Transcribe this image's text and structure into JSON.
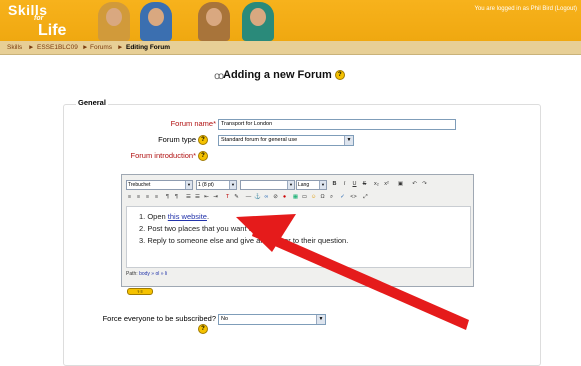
{
  "header": {
    "logo_line1": "Skills",
    "logo_line2": "for",
    "logo_line3": "Life",
    "logged_in_text": "You are logged in as Phil Bird (Logout)"
  },
  "breadcrumb": {
    "items": [
      "Skills",
      "ESSE1BLC09",
      "Forums",
      "Editing Forum"
    ],
    "separator": "►"
  },
  "page": {
    "title": "Adding a new Forum",
    "section_legend": "General"
  },
  "form": {
    "forum_name_label": "Forum name*",
    "forum_name_value": "Transport for London",
    "forum_type_label": "Forum type",
    "forum_type_value": "Standard forum for general use",
    "forum_intro_label": "Forum introduction*",
    "subscribe_label": "Force everyone to be subscribed?",
    "subscribe_value": "No"
  },
  "editor": {
    "font_value": "Trebuchet",
    "size_value": "1 (8 pt)",
    "style_value": "",
    "lang_value": "Lang",
    "content": {
      "item1_prefix": "1. Open ",
      "item1_link": "this website",
      "item1_suffix": ".",
      "item2": "2. Post two places that you want to go to.",
      "item3": "3. Reply to someone else and give an answer to their question."
    },
    "path_label": "Path:",
    "path_value": "body » ol » li"
  },
  "colors": {
    "header_bg": "#f0a810",
    "breadcrumb_bg": "#e7cf96",
    "arrow": "#e51b1b",
    "link": "#2233aa",
    "required": "#b01010"
  },
  "icons": [
    "forum-icon",
    "help-icon",
    "red-arrow"
  ]
}
